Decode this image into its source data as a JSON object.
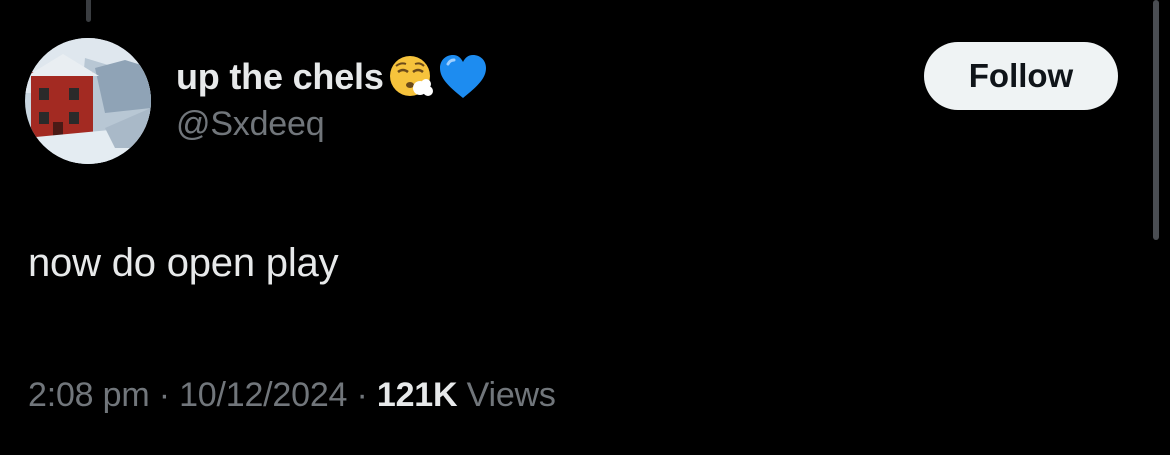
{
  "tweet": {
    "display_name": "up the chels",
    "name_emojis": [
      "face-exhaling-emoji",
      "blue-heart-emoji"
    ],
    "handle": "@Sxdeeq",
    "follow_label": "Follow",
    "text": "now do open play",
    "time": "2:08 pm",
    "separator": "·",
    "date": "10/12/2024",
    "views_count": "121K",
    "views_label": "Views"
  },
  "colors": {
    "background": "#000000",
    "primary_text": "#e7e9ea",
    "secondary_text": "#71767b",
    "follow_button_bg": "#eff3f4",
    "follow_button_text": "#0f1419",
    "heart": "#1d8cf0"
  }
}
